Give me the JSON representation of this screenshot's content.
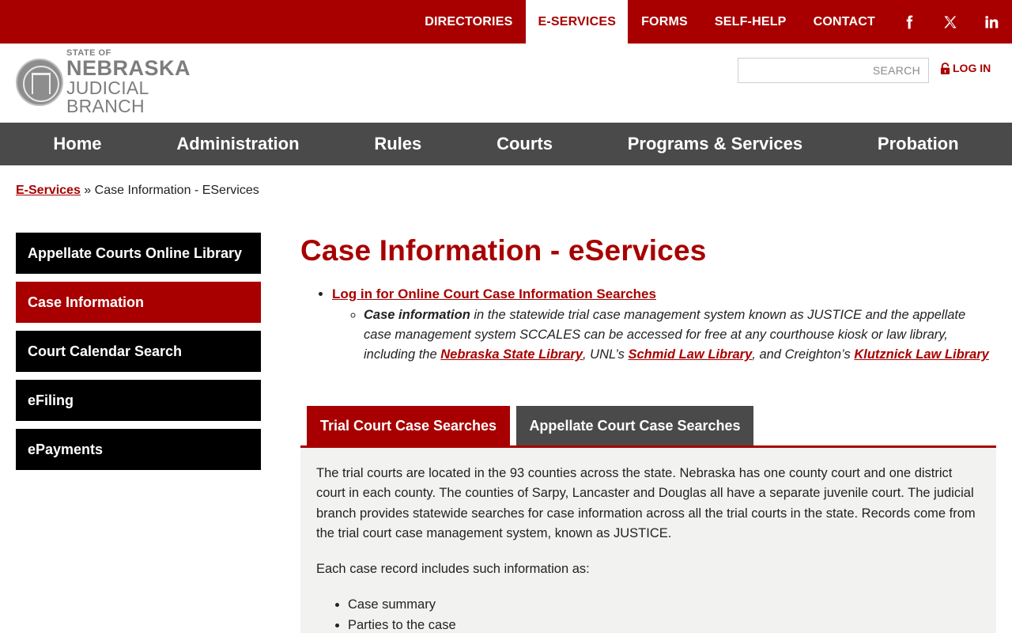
{
  "topnav": {
    "links": [
      "DIRECTORIES",
      "E-SERVICES",
      "FORMS",
      "SELF-HELP",
      "CONTACT"
    ],
    "active": "E-SERVICES",
    "social": [
      "facebook-icon",
      "x-icon",
      "linkedin-icon"
    ]
  },
  "logo": {
    "line1": "STATE OF",
    "line2": "NEBRASKA",
    "line3": "JUDICIAL BRANCH"
  },
  "search": {
    "placeholder": "SEARCH"
  },
  "login": {
    "label": "LOG IN"
  },
  "mainnav": [
    "Home",
    "Administration",
    "Rules",
    "Courts",
    "Programs & Services",
    "Probation"
  ],
  "breadcrumb": {
    "link": "E-Services",
    "separator": " » ",
    "current": "Case Information - EServices"
  },
  "sidebar": {
    "items": [
      "Appellate Courts Online Library",
      "Case Information",
      "Court Calendar Search",
      "eFiling",
      "ePayments"
    ],
    "active": "Case Information"
  },
  "content": {
    "title": "Case Information - eServices",
    "login_link": "Log in for Online Court Case Information Searches",
    "sub": {
      "strong": "Case information",
      "text1": " in the statewide trial case management system known as JUSTICE and the appellate case management system SCCALES can be accessed for free at any courthouse kiosk or law library, including the ",
      "link1": "Nebraska State Library",
      "text2": ", UNL’s ",
      "link2": "Schmid Law Library",
      "text3": ", and Creighton’s ",
      "link3": "Klutznick Law Library"
    }
  },
  "tabs": {
    "trial": "Trial Court Case Searches",
    "appellate": "Appellate Court Case Searches"
  },
  "panel": {
    "para1": "The trial courts are located in the 93 counties across the state.  Nebraska has one county court and one district court in each county.  The counties of Sarpy, Lancaster and Douglas all have a separate juvenile court.  The judicial branch provides statewide searches for case information across all the trial courts in the state.  Records come from the trial court case management system, known as JUSTICE.",
    "para2": "Each case record includes such information as:",
    "items": [
      "Case summary",
      "Parties to the case"
    ]
  },
  "colors": {
    "brand_red": "#a80000",
    "nav_gray": "#4a4a4a",
    "panel_bg": "#f2f2f0"
  }
}
